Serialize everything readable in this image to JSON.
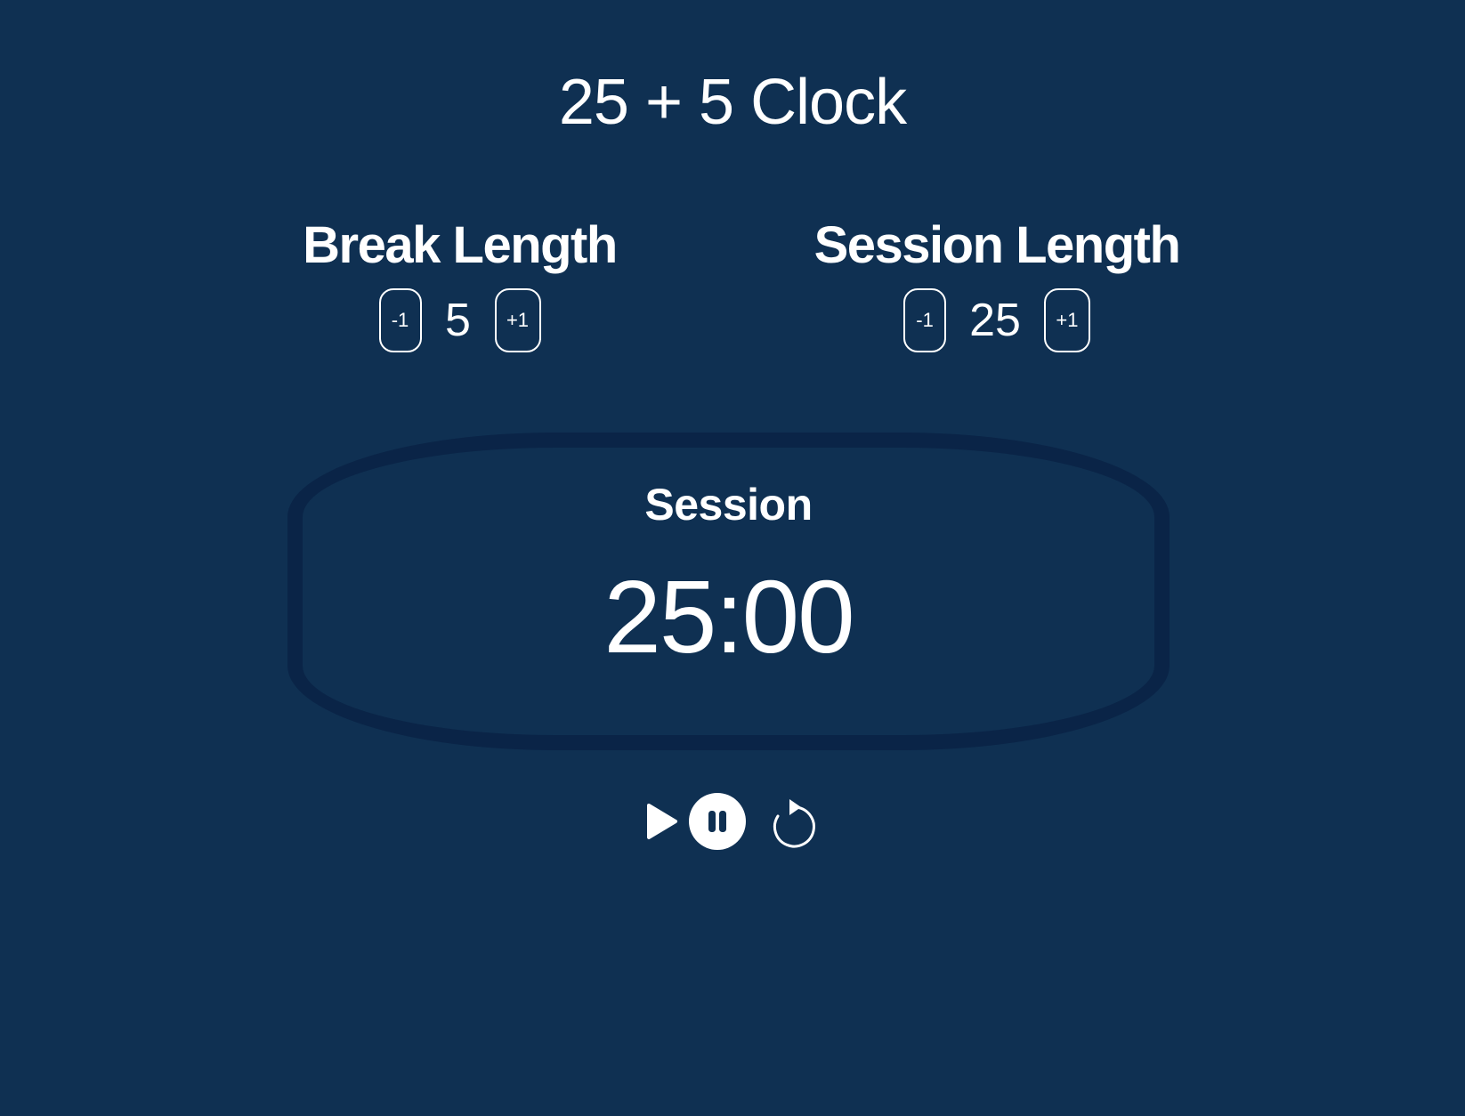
{
  "title": "25 + 5 Clock",
  "break": {
    "label": "Break Length",
    "decrement_label": "-1",
    "value": "5",
    "increment_label": "+1"
  },
  "session": {
    "label": "Session Length",
    "decrement_label": "-1",
    "value": "25",
    "increment_label": "+1"
  },
  "timer": {
    "label": "Session",
    "time": "25:00"
  },
  "controls": {
    "play_icon": "play-icon",
    "pause_icon": "pause-icon",
    "reset_icon": "refresh-icon"
  },
  "colors": {
    "background": "#0f3052",
    "panel_border": "#0a2447",
    "foreground": "#ffffff"
  }
}
